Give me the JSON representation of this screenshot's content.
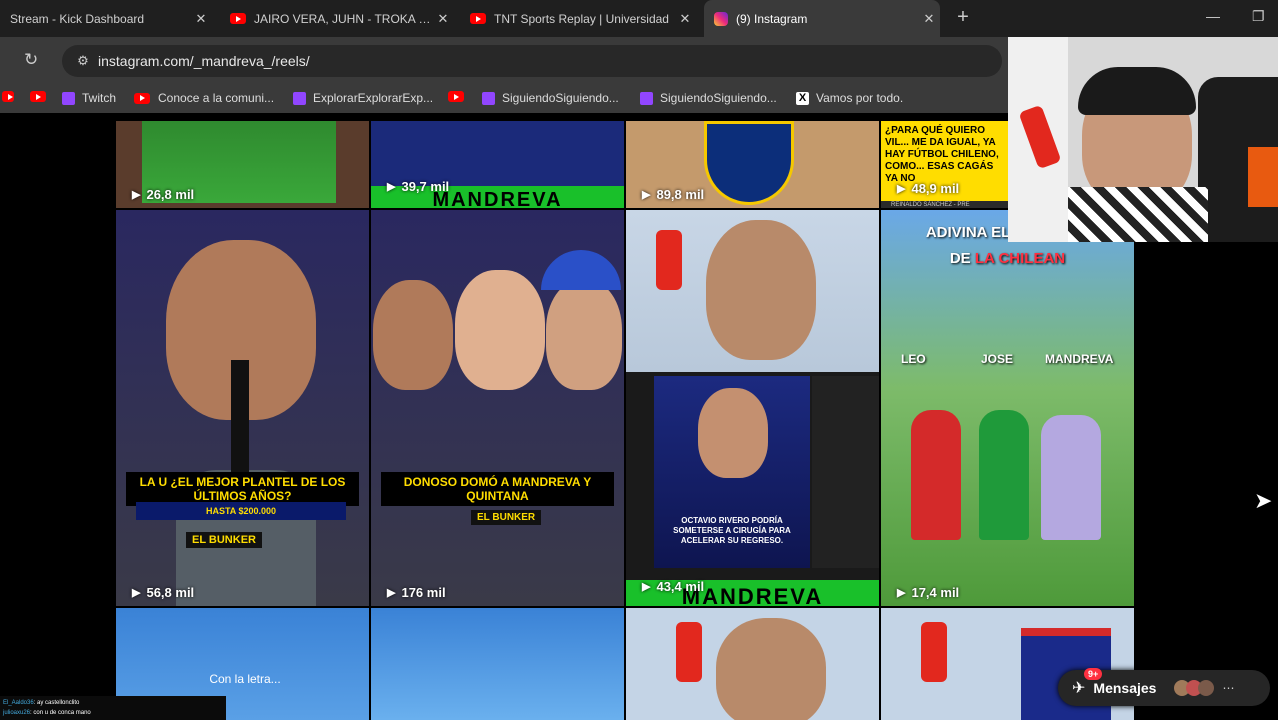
{
  "tabs": [
    {
      "title": "Stream - Kick Dashboard",
      "icon": "kick-icon"
    },
    {
      "title": "JAIRO VERA, JUHN - TROKA - YouTube",
      "icon": "youtube-icon"
    },
    {
      "title": "TNT Sports Replay | Universidad",
      "icon": "youtube-icon"
    },
    {
      "title": "(9) Instagram",
      "icon": "instagram-icon"
    }
  ],
  "address_bar": {
    "url": "instagram.com/_mandreva_/reels/"
  },
  "bookmarks": [
    {
      "label": "",
      "icon": "youtube-icon"
    },
    {
      "label": "",
      "icon": "youtube-icon"
    },
    {
      "label": "Twitch",
      "icon": "twitch-icon"
    },
    {
      "label": "Conoce a la comuni...",
      "icon": "youtube-icon"
    },
    {
      "label": "ExplorarExplorarExp...",
      "icon": "twitch-icon"
    },
    {
      "label": "",
      "icon": "youtube-icon"
    },
    {
      "label": "SiguiendoSiguiendo...",
      "icon": "twitch-icon"
    },
    {
      "label": "SiguiendoSiguiendo...",
      "icon": "twitch-icon"
    },
    {
      "label": "Vamos por todo.",
      "icon": "x-icon"
    }
  ],
  "reels": {
    "row1": [
      {
        "views": "26,8 mil"
      },
      {
        "views": "39,7 mil",
        "overlay": "MANDREVA"
      },
      {
        "views": "89,8 mil"
      },
      {
        "views": "48,9 mil",
        "caption": "¿PARA QUÉ QUIERO VIL... ME DA IGUAL, YA HAY FÚTBOL CHILENO, COMO... ESAS CAGÁS YA NO",
        "credit": "REINALDO SÁNCHEZ - PRE"
      }
    ],
    "row2": [
      {
        "views": "56,8 mil",
        "caption": "LA U ¿EL MEJOR PLANTEL DE LOS ÚLTIMOS AÑOS?",
        "promo": "HASTA $200.000",
        "brand": "EL BUNKER"
      },
      {
        "views": "176 mil",
        "caption": "DONOSO DOMÓ A MANDREVA Y QUINTANA",
        "brand": "EL BUNKER"
      },
      {
        "views": "43,4 mil",
        "headline": "OCTAVIO RIVERO PODRÍA SOMETERSE A CIRUGÍA PARA ACELERAR SU REGRESO.",
        "overlay": "MANDREVA"
      },
      {
        "views": "17,4 mil",
        "title_line1": "ADIVINA EL JUGADOR",
        "title_line2a": "DE ",
        "title_line2b": "LA CHILEAN",
        "names": [
          "LEO",
          "JOSE",
          "MANDREVA"
        ]
      }
    ],
    "row3": [
      {
        "caption": "Con la letra..."
      },
      {},
      {},
      {}
    ]
  },
  "messages": {
    "label": "Mensajes",
    "badge": "9+"
  },
  "chat": [
    {
      "user": "El_Aaldo36",
      "text": ": ay castellonclito"
    },
    {
      "user": "julioaxu26",
      "text": ": con u de conca mano"
    }
  ],
  "colors": {
    "accent": "#ff3040",
    "caption_yellow": "#ffdd00",
    "mandreva_green": "#19c02a",
    "la_u_blue": "#1a2a8a"
  }
}
